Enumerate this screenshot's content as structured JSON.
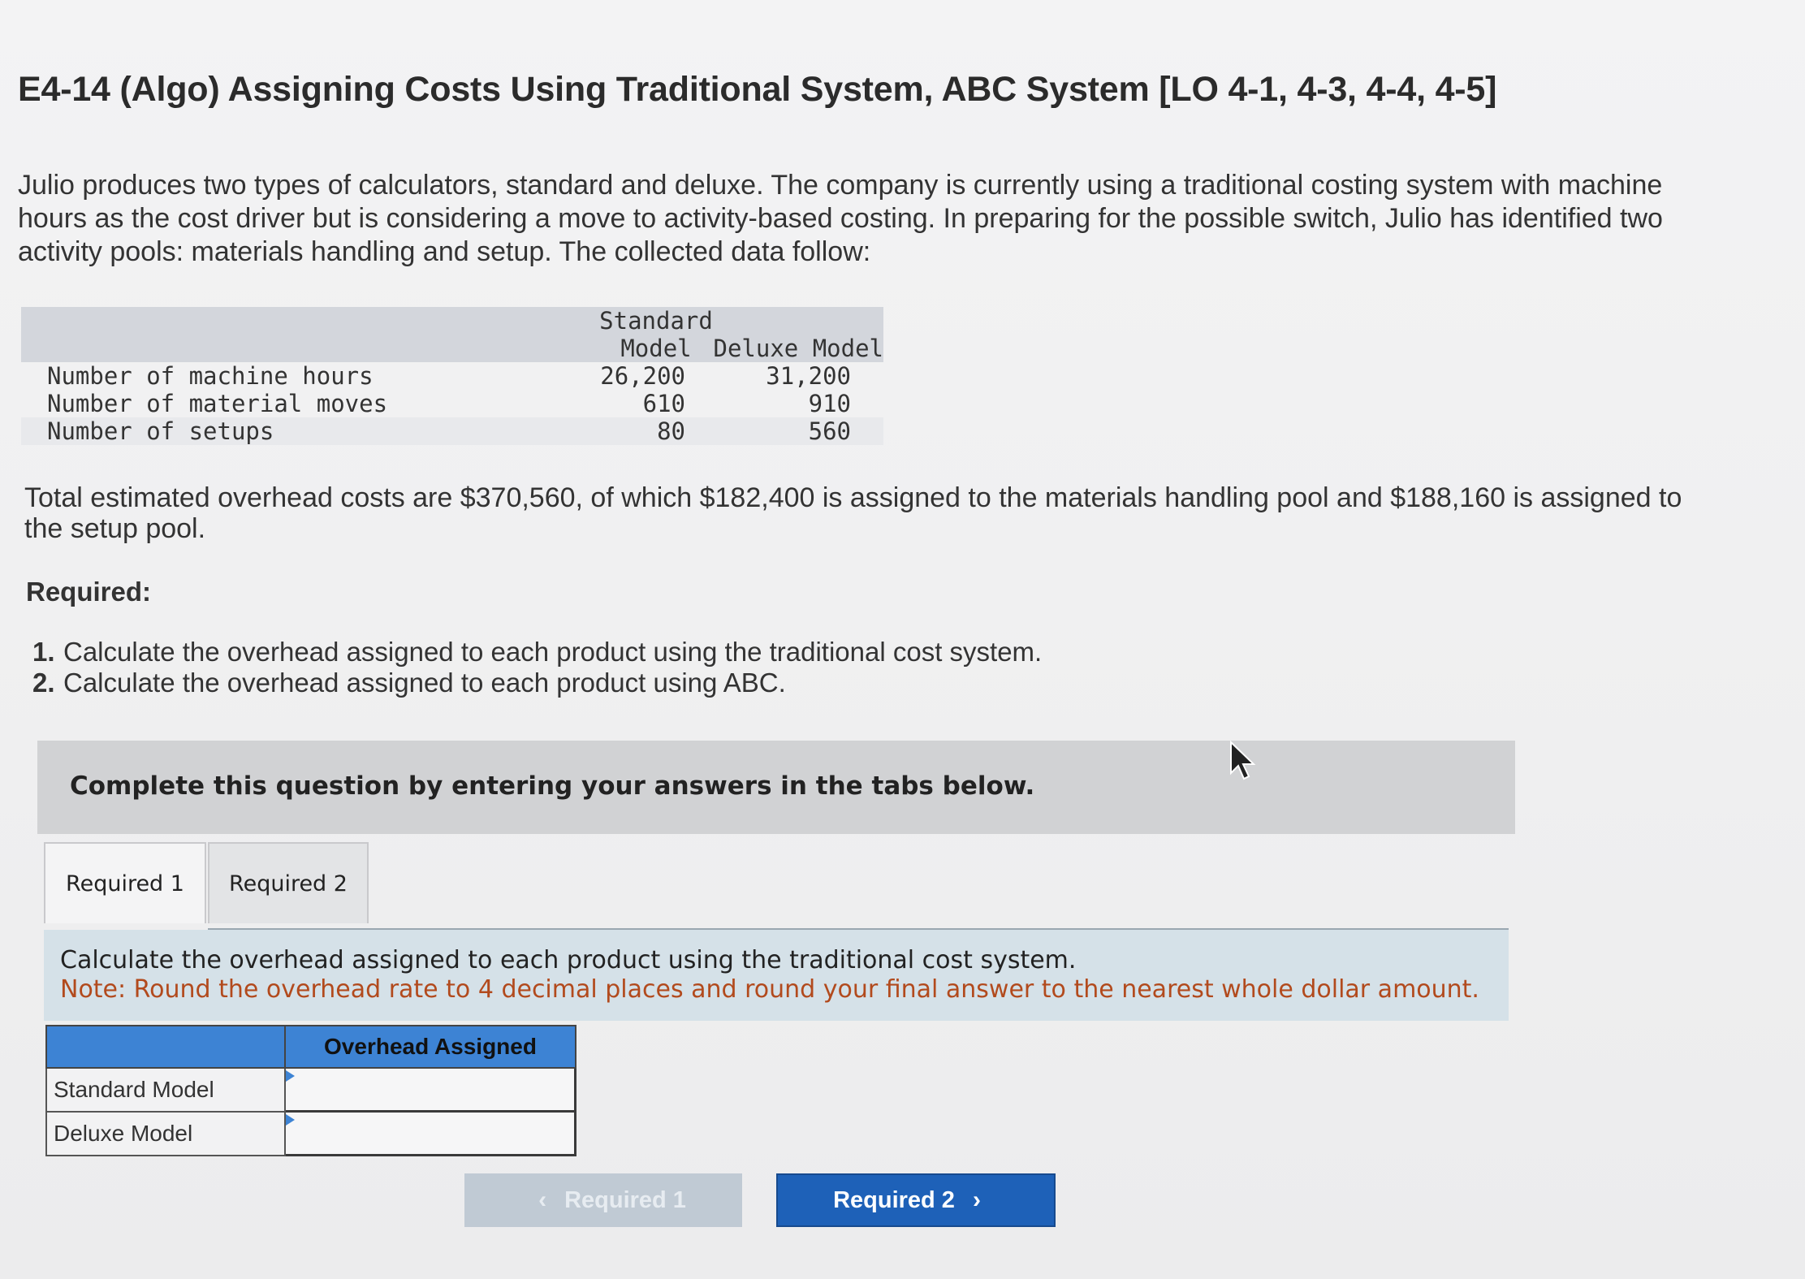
{
  "title": "E4-14 (Algo) Assigning Costs Using Traditional System, ABC System [LO 4-1, 4-3, 4-4, 4-5]",
  "intro": "Julio produces two types of calculators, standard and deluxe. The company is currently using a traditional costing system with machine hours as the cost driver but is considering a move to activity-based costing. In preparing for the possible switch, Julio has identified two activity pools: materials handling and setup. The collected data follow:",
  "data_table": {
    "columns": [
      "Standard Model",
      "Deluxe Model"
    ],
    "col_head_standard_line1": "Standard",
    "col_head_standard_line2": "Model",
    "col_head_deluxe": "Deluxe Model",
    "rows": [
      {
        "label": "Number of machine hours",
        "standard": "26,200",
        "deluxe": "31,200"
      },
      {
        "label": "Number of material moves",
        "standard": "610",
        "deluxe": "910"
      },
      {
        "label": "Number of setups",
        "standard": "80",
        "deluxe": "560"
      }
    ]
  },
  "overhead_paragraph": "Total estimated overhead costs are $370,560, of which $182,400 is assigned to the materials handling pool and $188,160 is assigned to the setup pool.",
  "required": {
    "label": "Required:",
    "items": [
      {
        "num": "1.",
        "text": "Calculate the overhead assigned to each product using the traditional cost system."
      },
      {
        "num": "2.",
        "text": "Calculate the overhead assigned to each product using ABC."
      }
    ]
  },
  "instruction": "Complete this question by entering your answers in the tabs below.",
  "tabs": [
    {
      "label": "Required 1",
      "active": true
    },
    {
      "label": "Required 2",
      "active": false
    }
  ],
  "note": {
    "line1": "Calculate the overhead assigned to each product using the traditional cost system.",
    "line2": "Note: Round the overhead rate to 4 decimal places and round your final answer to the nearest whole dollar amount."
  },
  "answer_table": {
    "header": "Overhead Assigned",
    "rows": [
      {
        "label": "Standard Model",
        "value": ""
      },
      {
        "label": "Deluxe Model",
        "value": ""
      }
    ]
  },
  "nav": {
    "prev_label": "Required 1",
    "next_label": "Required 2"
  },
  "colors": {
    "tab_header_blue": "#3d83d4",
    "next_button_blue": "#1e61b8",
    "note_text_orange": "#b24a1d",
    "note_box_bg": "#d5e1e8"
  }
}
